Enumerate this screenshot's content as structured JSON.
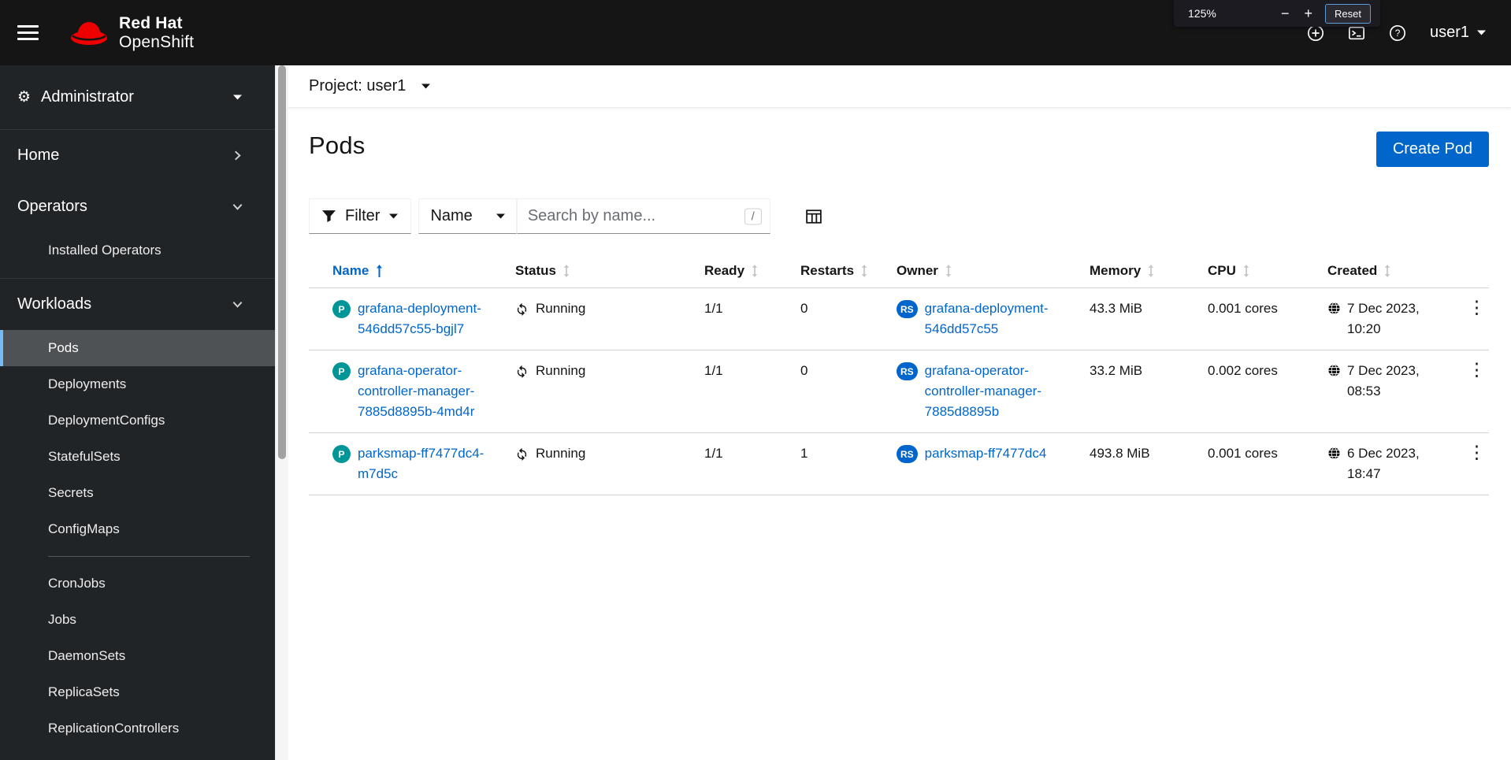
{
  "masthead": {
    "brand_line1": "Red Hat",
    "brand_line2": "OpenShift",
    "user_label": "user1",
    "zoom": {
      "level": "125%",
      "minus": "−",
      "plus": "+",
      "reset": "Reset"
    }
  },
  "sidebar": {
    "perspective": "Administrator",
    "sections": {
      "home": "Home",
      "operators": "Operators",
      "workloads": "Workloads"
    },
    "operators_items": [
      "Installed Operators"
    ],
    "workload_items": [
      "Pods",
      "Deployments",
      "DeploymentConfigs",
      "StatefulSets",
      "Secrets",
      "ConfigMaps",
      "CronJobs",
      "Jobs",
      "DaemonSets",
      "ReplicaSets",
      "ReplicationControllers"
    ],
    "selected_item": "Pods"
  },
  "project_bar": {
    "label": "Project: user1"
  },
  "page": {
    "title": "Pods",
    "create_button_label": "Create Pod"
  },
  "toolbar": {
    "filter_label": "Filter",
    "attribute_label": "Name",
    "search_placeholder": "Search by name...",
    "shortcut_hint": "/"
  },
  "table": {
    "columns": [
      "Name",
      "Status",
      "Ready",
      "Restarts",
      "Owner",
      "Memory",
      "CPU",
      "Created"
    ],
    "sorted_by": "Name",
    "sort_direction": "ascending",
    "rows": [
      {
        "badge": "P",
        "name": "grafana-deployment-546dd57c55-bgjl7",
        "status": "Running",
        "ready": "1/1",
        "restarts": "0",
        "owner_badge": "RS",
        "owner": "grafana-deployment-546dd57c55",
        "memory": "43.3 MiB",
        "cpu": "0.001 cores",
        "created": "7 Dec 2023, 10:20"
      },
      {
        "badge": "P",
        "name": "grafana-operator-controller-manager-7885d8895b-4md4r",
        "status": "Running",
        "ready": "1/1",
        "restarts": "0",
        "owner_badge": "RS",
        "owner": "grafana-operator-controller-manager-7885d8895b",
        "memory": "33.2 MiB",
        "cpu": "0.002 cores",
        "created": "7 Dec 2023, 08:53"
      },
      {
        "badge": "P",
        "name": "parksmap-ff7477dc4-m7d5c",
        "status": "Running",
        "ready": "1/1",
        "restarts": "1",
        "owner_badge": "RS",
        "owner": "parksmap-ff7477dc4",
        "memory": "493.8 MiB",
        "cpu": "0.001 cores",
        "created": "6 Dec 2023, 18:47"
      }
    ]
  },
  "icons": {
    "gear": "⚙",
    "kebab": "⋮"
  },
  "colors": {
    "primary_blue": "#0066cc",
    "masthead_bg": "#151515",
    "sidebar_bg": "#212427",
    "selected_nav_bg": "#4f5255",
    "selected_nav_border": "#73bcf7",
    "pod_badge": "#009596",
    "replicaset_badge": "#0066cc",
    "logo_red": "#ee0000"
  }
}
